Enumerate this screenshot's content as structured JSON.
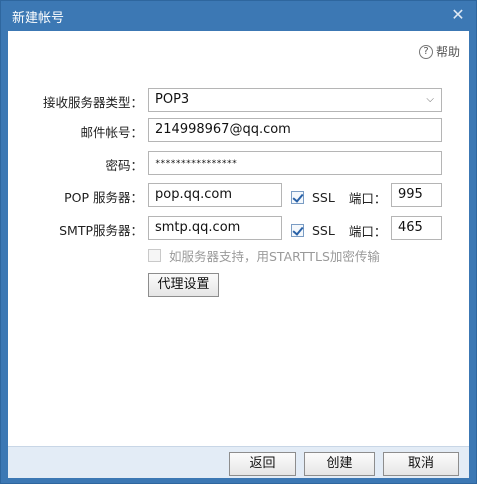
{
  "window": {
    "title": "新建帐号"
  },
  "help": {
    "label": "帮助"
  },
  "form": {
    "server_type": {
      "label": "接收服务器类型：",
      "value": "POP3"
    },
    "email": {
      "label": "邮件帐号：",
      "value": "214998967@qq.com"
    },
    "password": {
      "label": "密码：",
      "value": "****************"
    },
    "pop": {
      "label": "POP 服务器：",
      "value": "pop.qq.com",
      "ssl_label": "SSL",
      "ssl_checked": true,
      "port_label": "端口：",
      "port": "995"
    },
    "smtp": {
      "label": "SMTP服务器：",
      "value": "smtp.qq.com",
      "ssl_label": "SSL",
      "ssl_checked": true,
      "port_label": "端口：",
      "port": "465"
    },
    "starttls": {
      "label": "如服务器支持，用STARTTLS加密传输",
      "checked": false,
      "enabled": false
    },
    "proxy_button": "代理设置"
  },
  "footer": {
    "back": "返回",
    "create": "创建",
    "cancel": "取消"
  },
  "icons": {
    "close": "close-icon",
    "help": "help-circle-icon",
    "dropdown": "chevron-down-icon",
    "check": "check-icon"
  },
  "colors": {
    "titlebar": "#3c78b4",
    "window_border": "#2e669e",
    "footer": "#e3ecf6",
    "checkbox_accent": "#2a62a8"
  }
}
